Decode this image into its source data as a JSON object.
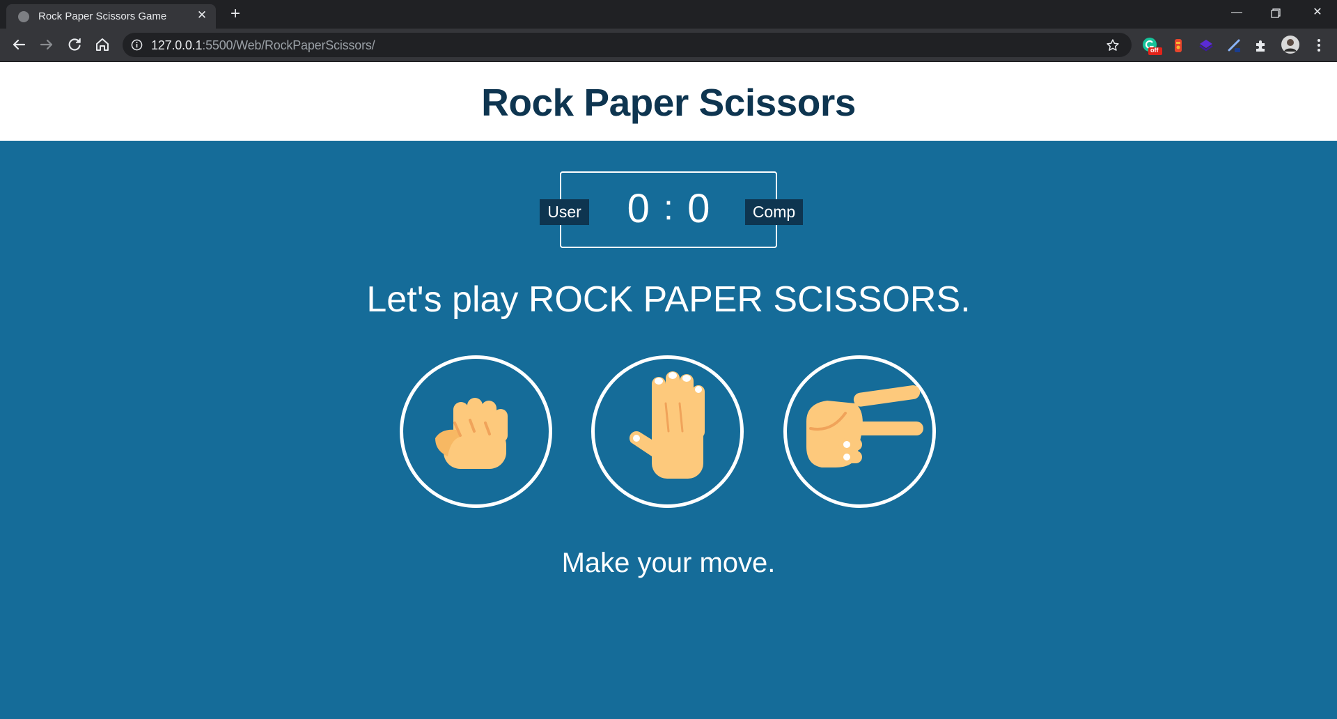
{
  "browser": {
    "tab_title": "Rock Paper Scissors Game",
    "url_host": "127.0.0.1",
    "url_rest": ":5500/Web/RockPaperScissors/",
    "window_controls": [
      "minimize-icon",
      "restore-icon",
      "close-icon"
    ],
    "toolbar_icons": [
      "back-arrow-icon",
      "forward-arrow-icon",
      "reload-icon",
      "home-icon",
      "info-icon",
      "bookmark-star-icon"
    ],
    "extension_icons": [
      "grammarly-icon",
      "extension-red-icon",
      "extension-purple-icon",
      "extension-pen-icon",
      "puzzle-icon",
      "profile-avatar",
      "menu-dots-icon"
    ],
    "grammarly_badge": "off"
  },
  "header": {
    "title": "Rock Paper Scissors"
  },
  "scoreboard": {
    "user_label": "User",
    "comp_label": "Comp",
    "user_score": "0",
    "separator": ":",
    "comp_score": "0"
  },
  "prompt": "Let's play ROCK PAPER SCISSORS.",
  "choices": [
    {
      "id": "rock",
      "icon": "rock-fist-icon"
    },
    {
      "id": "paper",
      "icon": "paper-hand-icon"
    },
    {
      "id": "scissors",
      "icon": "scissors-hand-icon"
    }
  ],
  "message": "Make your move.",
  "colors": {
    "background": "#156c99",
    "header_bg": "#ffffff",
    "title": "#0e3550",
    "badge_bg": "#0e3550",
    "skin": "#fdc97c",
    "skin_shade": "#f0a35a"
  }
}
